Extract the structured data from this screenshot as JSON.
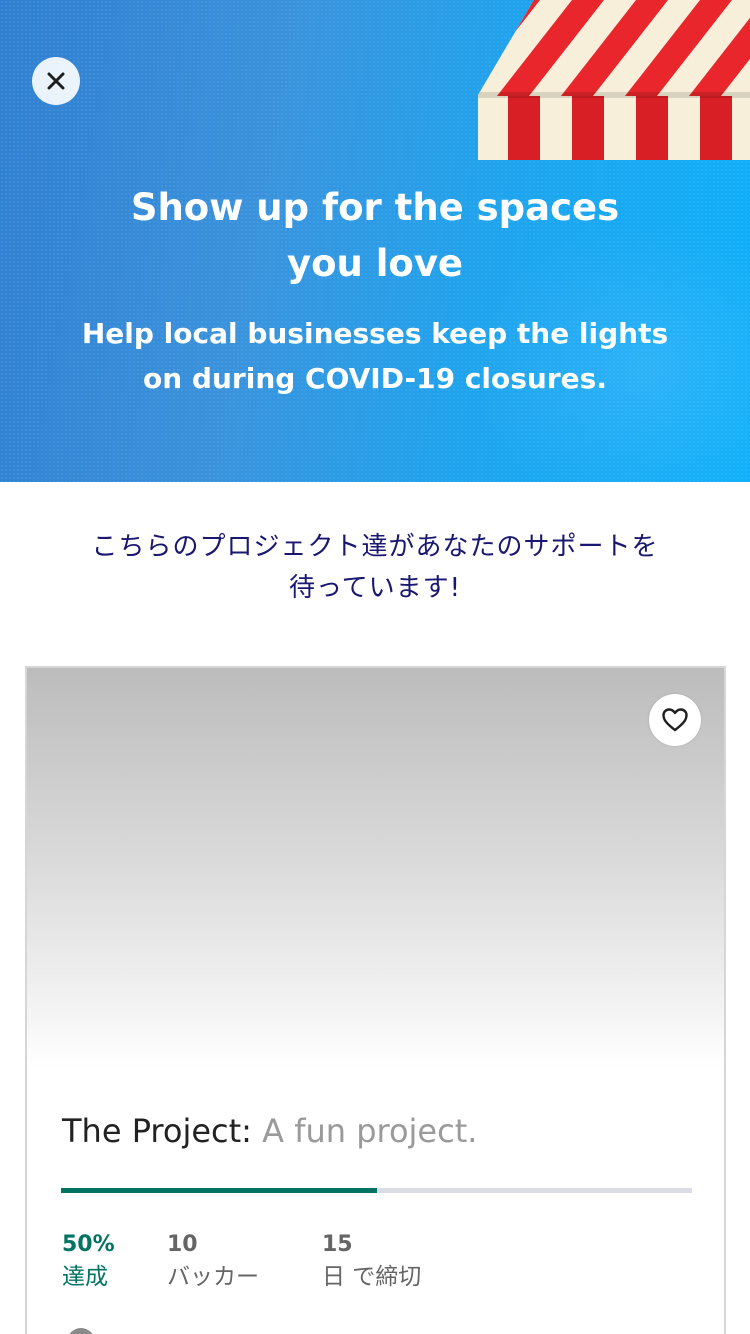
{
  "hero": {
    "title_line1": "Show up for the spaces",
    "title_line2": "you love",
    "subtitle_line1": "Help local businesses keep the lights",
    "subtitle_line2": "on during COVID-19 closures.",
    "close_icon": "close-icon",
    "awning_colors": [
      "#e8262c",
      "#f7efd9"
    ]
  },
  "section": {
    "heading_line1": "こちらのプロジェクト達があなたのサポートを",
    "heading_line2": "待っています!"
  },
  "project_card": {
    "name": "The Project:",
    "blurb": "A fun project.",
    "favorite_icon": "heart-icon",
    "progress_fraction": 0.5,
    "stats": {
      "funded_value": "50%",
      "funded_label": "達成",
      "backers_value": "10",
      "backers_label": "バッカー",
      "days_value": "15",
      "days_label": "日 で締切"
    }
  },
  "colors": {
    "accent_green": "#037362",
    "heading_navy": "#1a1770",
    "hero_blue": "#1ea4ee"
  }
}
